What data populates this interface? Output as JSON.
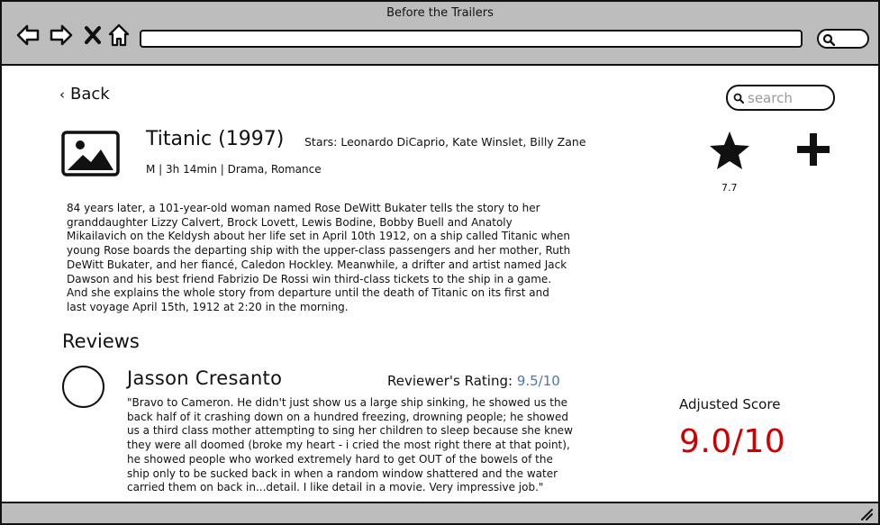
{
  "window": {
    "title": "Before the Trailers"
  },
  "browser": {
    "url_value": "",
    "search_placeholder": ""
  },
  "page": {
    "back_label": "Back",
    "search_placeholder": "search"
  },
  "movie": {
    "title": "Titanic (1997)",
    "stars": "Stars: Leonardo DiCaprio, Kate Winslet, Billy Zane",
    "meta": "M | 3h 14min | Drama, Romance",
    "rating": "7.7",
    "synopsis": "84 years later, a 101-year-old woman named Rose DeWitt Bukater tells the story to her granddaughter Lizzy Calvert, Brock Lovett, Lewis Bodine, Bobby Buell and Anatoly Mikailavich on the Keldysh about her life set in April 10th 1912, on a ship called Titanic when young Rose boards the departing ship with the upper-class passengers and her mother, Ruth DeWitt Bukater, and her fiancé, Caledon Hockley. Meanwhile, a drifter and artist named Jack Dawson and his best friend Fabrizio De Rossi win third-class tickets to the ship in a game. And she explains the whole story from departure until the death of Titanic on its first and last voyage April 15th, 1912 at 2:20 in the morning."
  },
  "reviews": {
    "heading": "Reviews",
    "items": [
      {
        "name": "Jasson Cresanto",
        "rating_label": "Reviewer's Rating:",
        "rating_value": "9.5/10",
        "text": "\"Bravo to Cameron. He didn't just show us a large ship sinking, he showed us the back half of it crashing down on a hundred freezing, drowning people; he showed us a third class mother attempting to sing her children to sleep because she knew they were all doomed (broke my heart - i cried the most right there at that point), he showed people who worked extremely hard to get OUT of the bowels of the ship only to be sucked back in when a random window shattered and the water carried them on back in...detail. I like detail in a movie. Very impressive job.\"",
        "adjusted_label": "Adjusted Score",
        "adjusted_value": "9.0/10"
      }
    ]
  },
  "colors": {
    "chrome": "#bdbdbd",
    "rating_blue": "#4a77b4",
    "score_red": "#cc0000"
  },
  "icons": [
    "back-arrow-icon",
    "forward-arrow-icon",
    "close-icon",
    "home-icon",
    "search-icon",
    "chevron-left-icon",
    "image-placeholder-icon",
    "star-icon",
    "plus-icon",
    "resize-grip-icon"
  ]
}
